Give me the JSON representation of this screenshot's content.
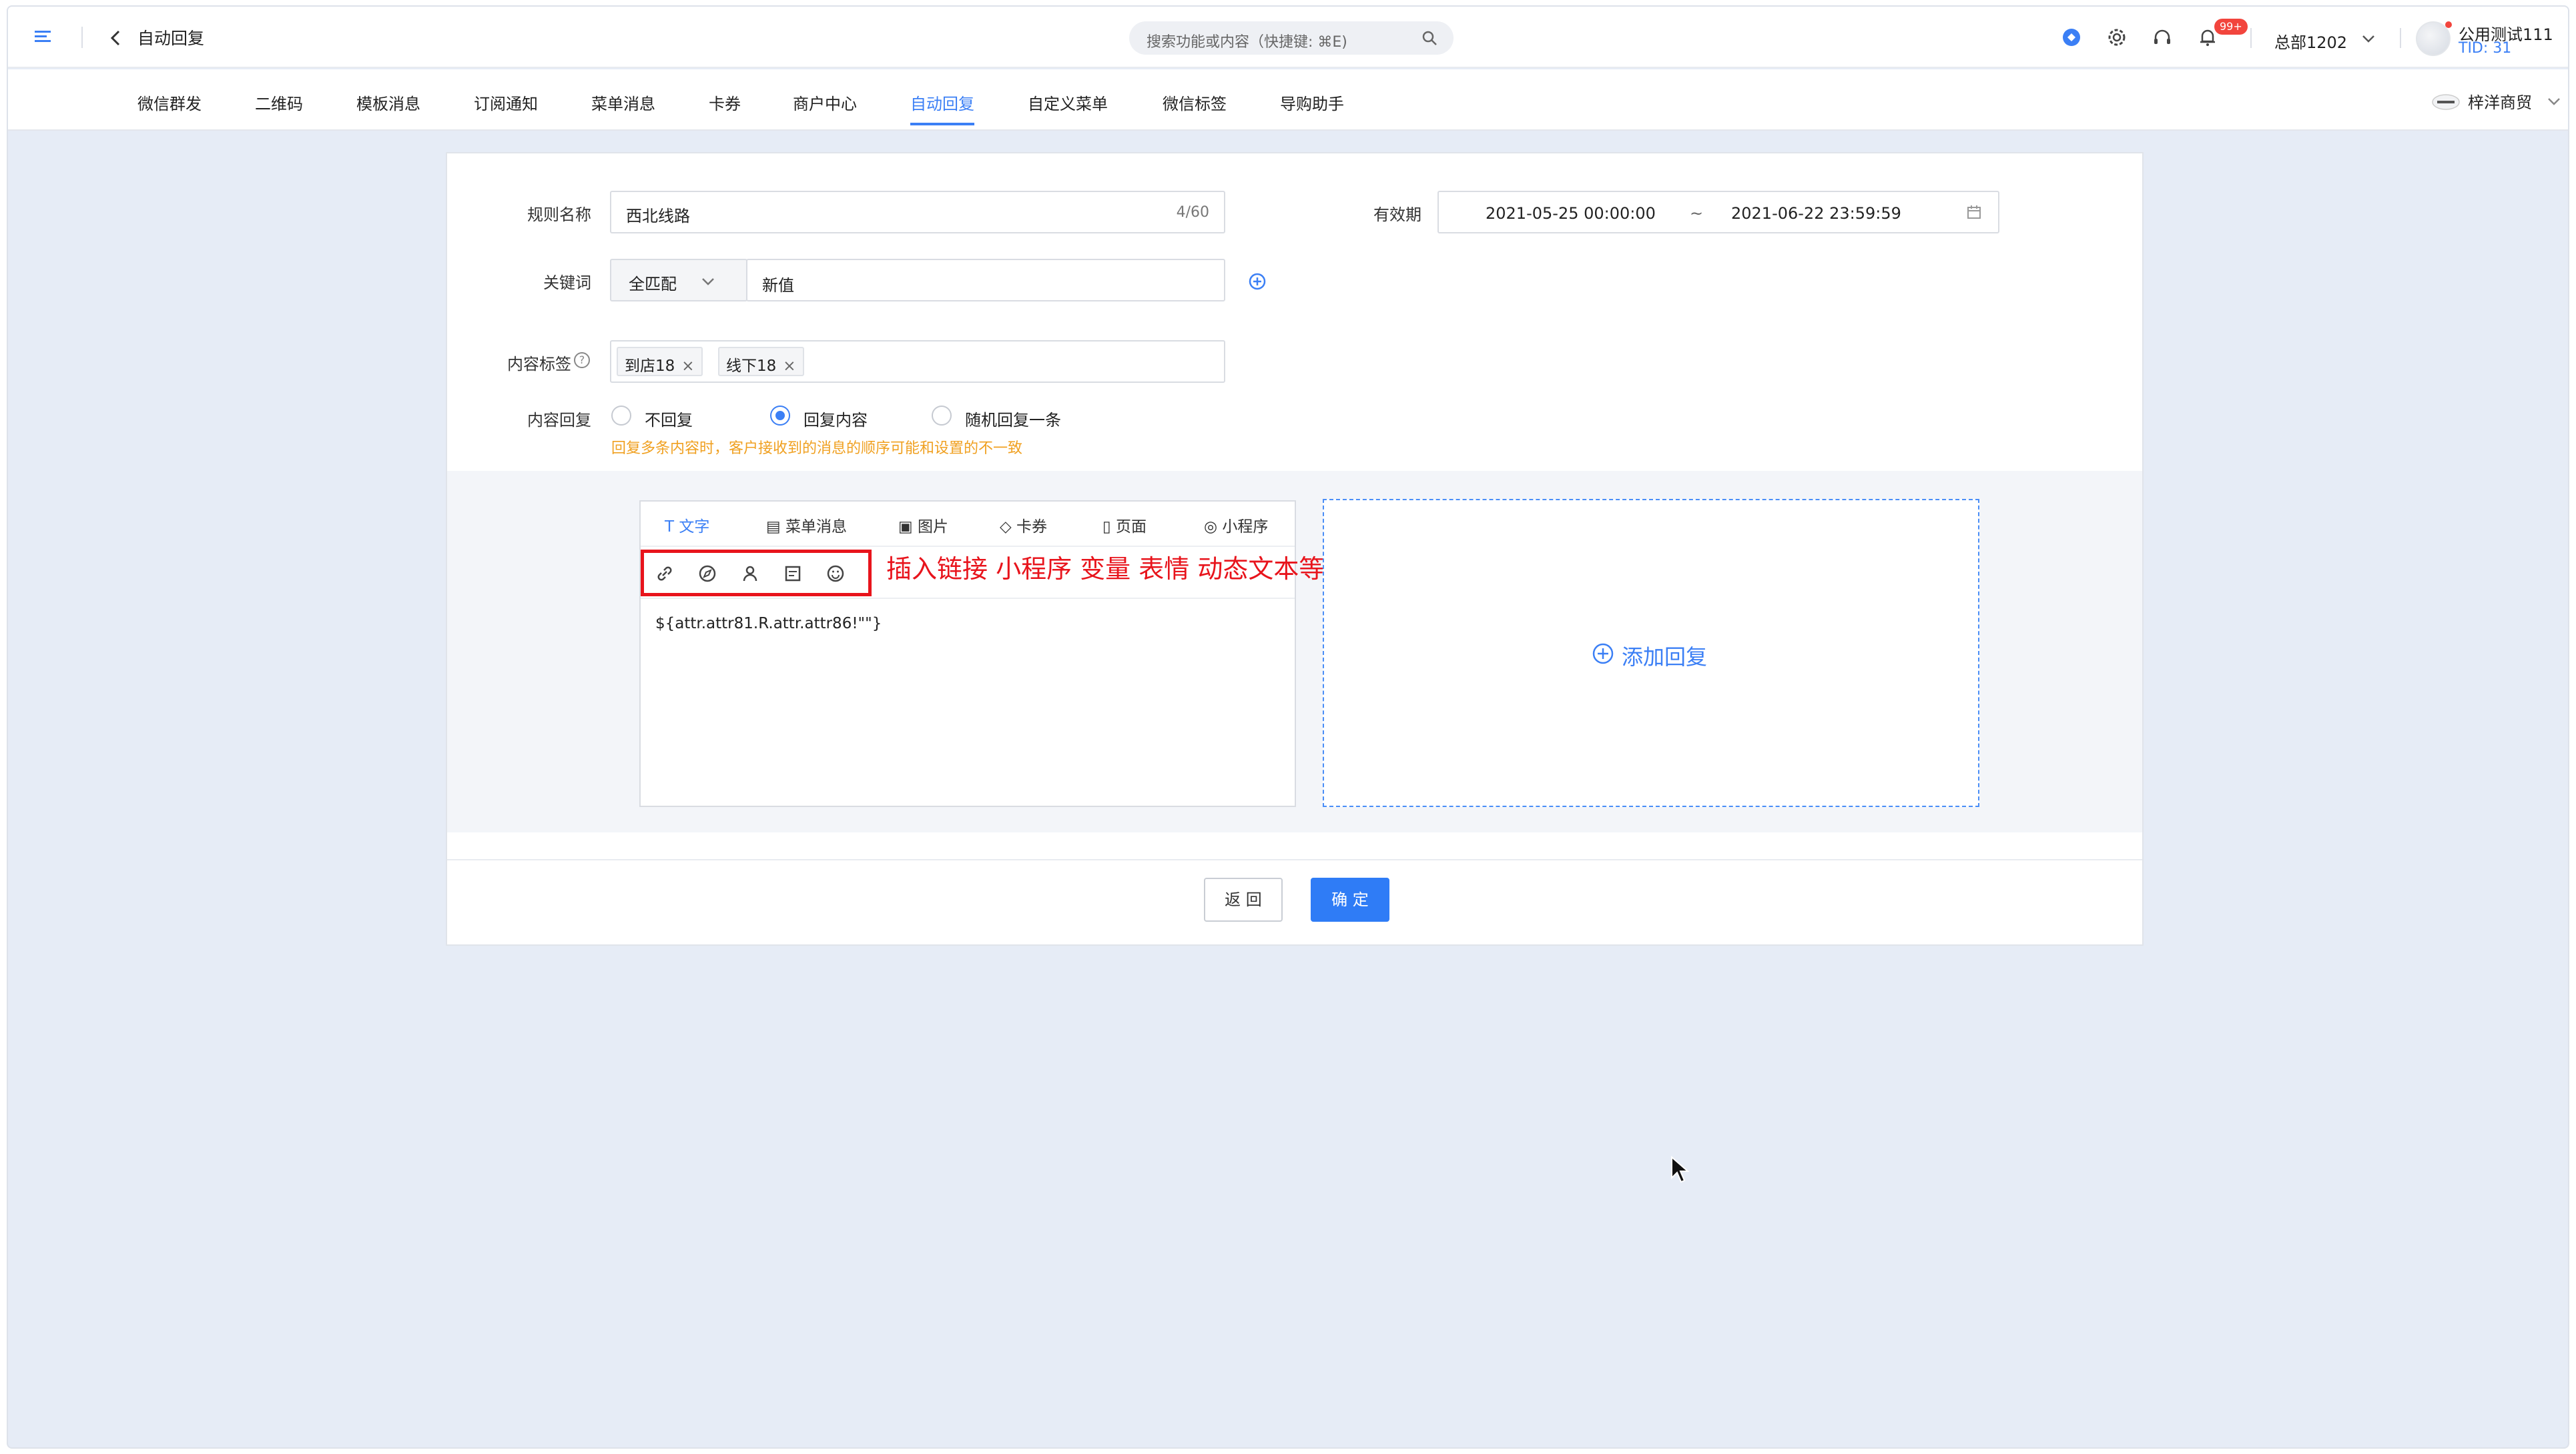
{
  "header": {
    "page_title": "自动回复",
    "search_placeholder": "搜索功能或内容（快捷键: ⌘E)",
    "notification_badge": "99+",
    "org_name": "总部1202",
    "user_name": "公用测试111",
    "tid": "TID: 31"
  },
  "nav": {
    "items": [
      "微信群发",
      "二维码",
      "模板消息",
      "订阅通知",
      "菜单消息",
      "卡券",
      "商户中心",
      "自动回复",
      "自定义菜单",
      "微信标签",
      "导购助手"
    ],
    "active_index": 7,
    "shop_name": "梓洋商贸"
  },
  "form": {
    "rule_name_label": "规则名称",
    "rule_name_value": "西北线路",
    "rule_name_counter": "4/60",
    "validity_label": "有效期",
    "start_date": "2021-05-25 00:00:00",
    "date_sep": "~",
    "end_date": "2021-06-22 23:59:59",
    "keyword_label": "关键词",
    "match_mode": "全匹配",
    "keyword_value": "新值",
    "content_tags_label": "内容标签",
    "help_mark": "?",
    "tags": [
      "到店18",
      "线下18"
    ],
    "tag_remove": "×",
    "reply_label": "内容回复",
    "reply_options": [
      "不回复",
      "回复内容",
      "随机回复一条"
    ],
    "reply_selected_index": 1,
    "hint": "回复多条内容时，客户接收到的消息的顺序可能和设置的不一致"
  },
  "editor": {
    "tabs": [
      "文字",
      "菜单消息",
      "图片",
      "卡券",
      "页面",
      "小程序"
    ],
    "active_tab": 0,
    "tool_icons": [
      "link-icon",
      "compass-icon",
      "person-icon",
      "text-box-icon",
      "emoji-icon"
    ],
    "annotation": "插入链接 小程序 变量 表情 动态文本等",
    "content": "${attr.attr81.R.attr.attr86!\"\"}",
    "add_reply": "添加回复"
  },
  "buttons": {
    "back": "返 回",
    "confirm": "确 定"
  },
  "colors": {
    "accent": "#3b7ff5",
    "annotation_red": "#e8141c",
    "hint_orange": "#f0a020",
    "background": "#e6ecf6"
  }
}
